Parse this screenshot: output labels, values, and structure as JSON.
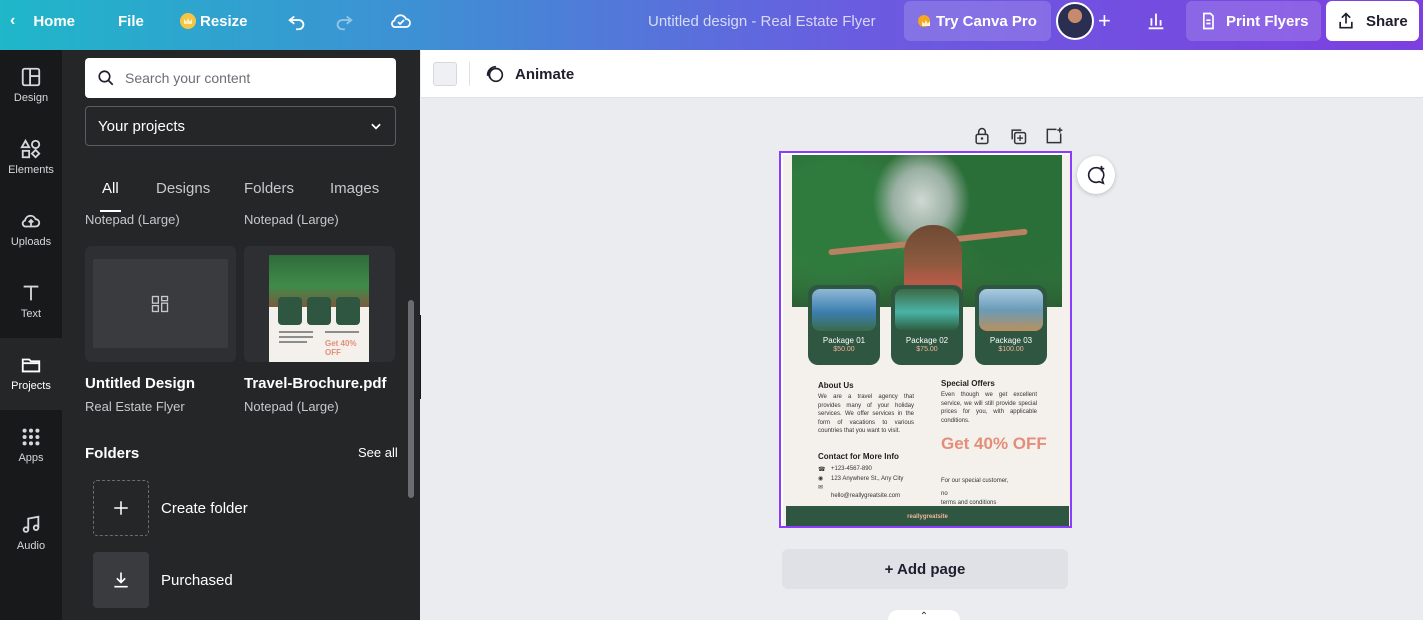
{
  "topbar": {
    "home_label": "Home",
    "file_label": "File",
    "resize_label": "Resize",
    "design_title": "Untitled design - Real Estate Flyer",
    "try_pro_label": "Try Canva Pro",
    "print_label": "Print Flyers",
    "share_label": "Share"
  },
  "rail": {
    "items": [
      {
        "label": "Design",
        "icon": "design-icon"
      },
      {
        "label": "Elements",
        "icon": "elements-icon"
      },
      {
        "label": "Uploads",
        "icon": "uploads-icon"
      },
      {
        "label": "Text",
        "icon": "text-icon"
      },
      {
        "label": "Projects",
        "icon": "folder-icon"
      },
      {
        "label": "Apps",
        "icon": "apps-icon"
      },
      {
        "label": "Audio",
        "icon": "audio-icon"
      }
    ]
  },
  "panel": {
    "search_placeholder": "Search your content",
    "dropdown_value": "Your projects",
    "tabs": [
      "All",
      "Designs",
      "Folders",
      "Images"
    ],
    "top_captions": [
      "Notepad (Large)",
      "Notepad (Large)"
    ],
    "cards": [
      {
        "name": "Untitled Design",
        "type": "Real Estate Flyer"
      },
      {
        "name": "Travel-Brochure.pdf",
        "type": "Notepad (Large)"
      }
    ],
    "folders_heading": "Folders",
    "see_all_label": "See all",
    "folders": [
      {
        "label": "Create folder",
        "icon": "plus-icon"
      },
      {
        "label": "Purchased",
        "icon": "download-icon"
      }
    ],
    "thumb_mini_offer": "Get 40% OFF"
  },
  "toolbar": {
    "animate_label": "Animate"
  },
  "flyer": {
    "packages": [
      {
        "name": "Package 01",
        "price": "$50.00"
      },
      {
        "name": "Package 02",
        "price": "$75.00"
      },
      {
        "name": "Package 03",
        "price": "$100.00"
      }
    ],
    "about_heading": "About Us",
    "about_text": "We are a travel agency that provides many of your holiday services. We offer services in the form of vacations to various countries that you want to visit.",
    "contact_heading": "Contact for More Info",
    "contact_phone": "+123-4567-890",
    "contact_address": "123 Anywhere St., Any City",
    "contact_email": "hello@reallygreatsite.com",
    "offers_heading": "Special Offers",
    "offers_text": "Even though we get excellent service, we will still provide special prices for you, with applicable conditions.",
    "offer_big": "Get 40% OFF",
    "offer_small_1": "For our special customer,",
    "offer_small_2": "no",
    "offer_small_3": "terms and conditions",
    "footer_text": "reallygreatsite"
  },
  "canvas": {
    "add_page_label": "+ Add page"
  }
}
